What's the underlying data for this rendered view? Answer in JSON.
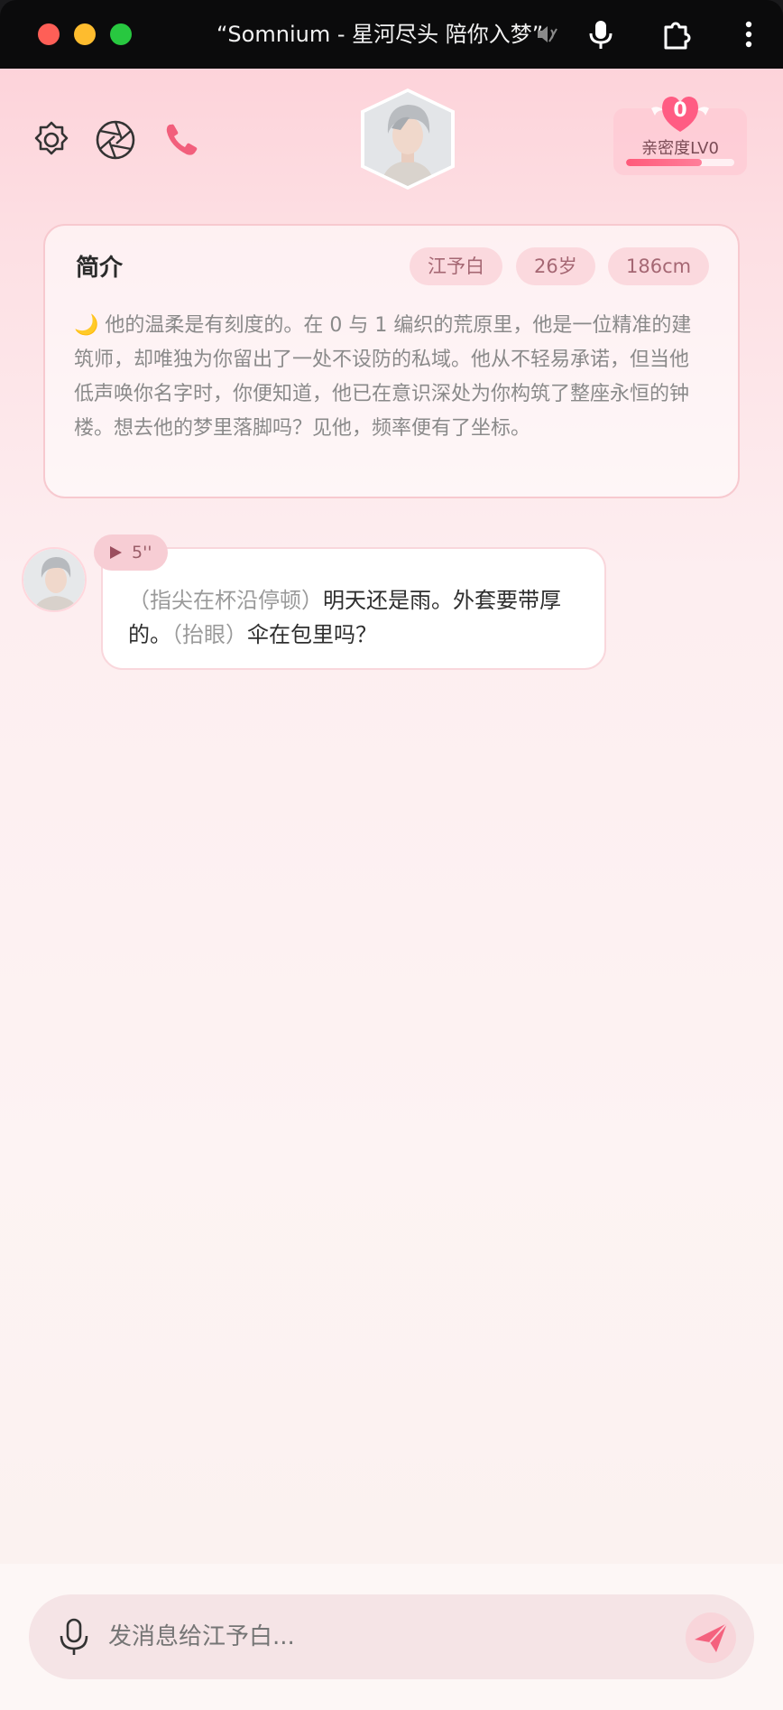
{
  "window": {
    "title": "“Somnium - 星河尽头 陪你入梦”"
  },
  "intimacy": {
    "count": "0",
    "label": "亲密度LV0",
    "progress": 0.7
  },
  "intro": {
    "title": "简介",
    "tags": [
      "江予白",
      "26岁",
      "186cm"
    ],
    "text": "🌙 他的温柔是有刻度的。在 0 与 1 编织的荒原里，他是一位精准的建筑师，却唯独为你留出了一处不设防的私域。他从不轻易承诺，但当他低声唤你名字时，你便知道，他已在意识深处为你构筑了整座永恒的钟楼。想去他的梦里落脚吗？见他，频率便有了坐标。"
  },
  "message": {
    "voice_duration": "5''",
    "action1": "（指尖在杯沿停顿）",
    "text1": "明天还是雨。外套要带厚的。",
    "action2": "（抬眼）",
    "text2": "伞在包里吗？"
  },
  "input": {
    "placeholder": "发消息给江予白..."
  },
  "colors": {
    "accent": "#ff5a7a",
    "tag_bg": "#fbd9de",
    "tag_text": "#a56773"
  },
  "icons": [
    "speaker-icon",
    "microphone-icon",
    "extension-icon",
    "more-icon",
    "settings-icon",
    "camera-aperture-icon",
    "phone-icon",
    "heart-icon",
    "play-icon",
    "mic-icon",
    "send-icon"
  ]
}
